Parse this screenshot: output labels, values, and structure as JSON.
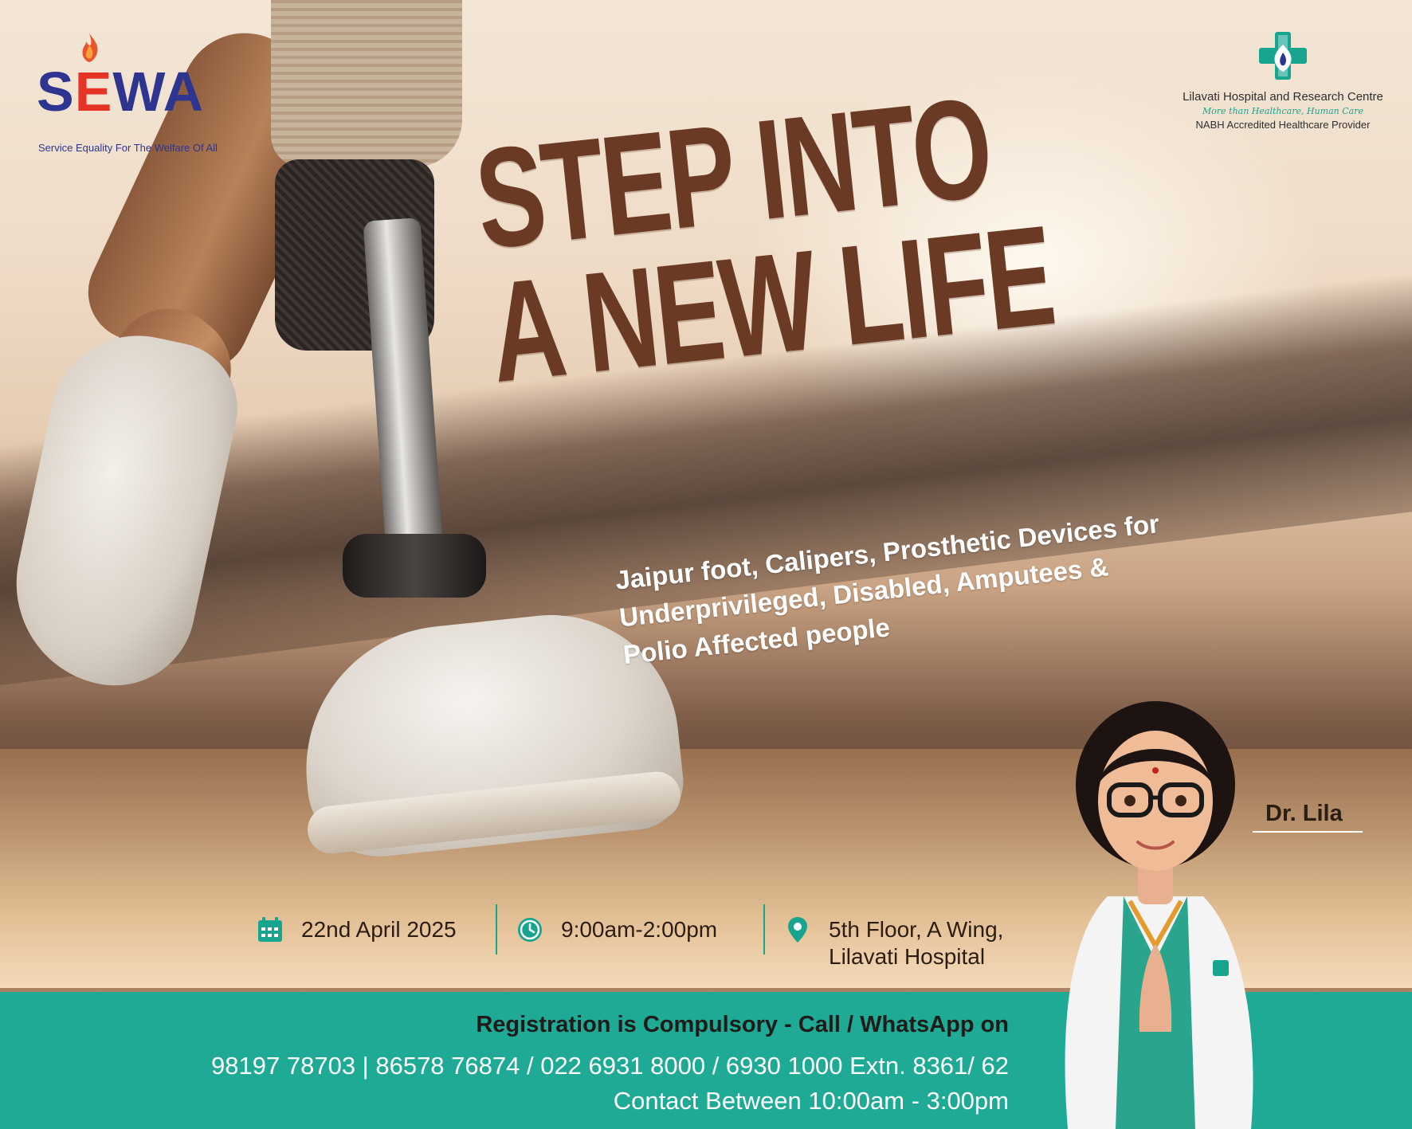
{
  "sewa": {
    "logo_text_left": "S",
    "logo_text_e": "E",
    "logo_text_right": "WA",
    "tagline": "Service Equality For The Welfare Of All"
  },
  "lilavati": {
    "name": "Lilavati Hospital and Research Centre",
    "tagline": "More than Healthcare, Human Care",
    "accreditation": "NABH Accredited Healthcare Provider"
  },
  "headline": {
    "line1": "STEP INTO",
    "line2": "A NEW LIFE"
  },
  "subhead": {
    "line1": "Jaipur foot, Calipers, Prosthetic Devices for",
    "line2": "Underprivileged, Disabled, Amputees &",
    "line3": "Polio Affected people"
  },
  "event": {
    "date": "22nd April 2025",
    "time": "9:00am-2:00pm",
    "venue_line1": "5th Floor, A Wing,",
    "venue_line2": "Lilavati Hospital"
  },
  "footer": {
    "registration": "Registration is Compulsory - Call / WhatsApp on",
    "phones": "98197 78703 | 86578 76874 / 022 6931 8000 / 6930 1000 Extn. 8361/ 62",
    "contact_hours": "Contact Between 10:00am - 3:00pm"
  },
  "doctor": {
    "name": "Dr. Lila"
  },
  "colors": {
    "teal": "#1eaa94",
    "headline_brown": "#6b3a25",
    "sewa_blue": "#2e3591",
    "sewa_red": "#e53325"
  },
  "icons": {
    "date": "calendar-icon",
    "time": "clock-icon",
    "venue": "location-pin-icon"
  }
}
